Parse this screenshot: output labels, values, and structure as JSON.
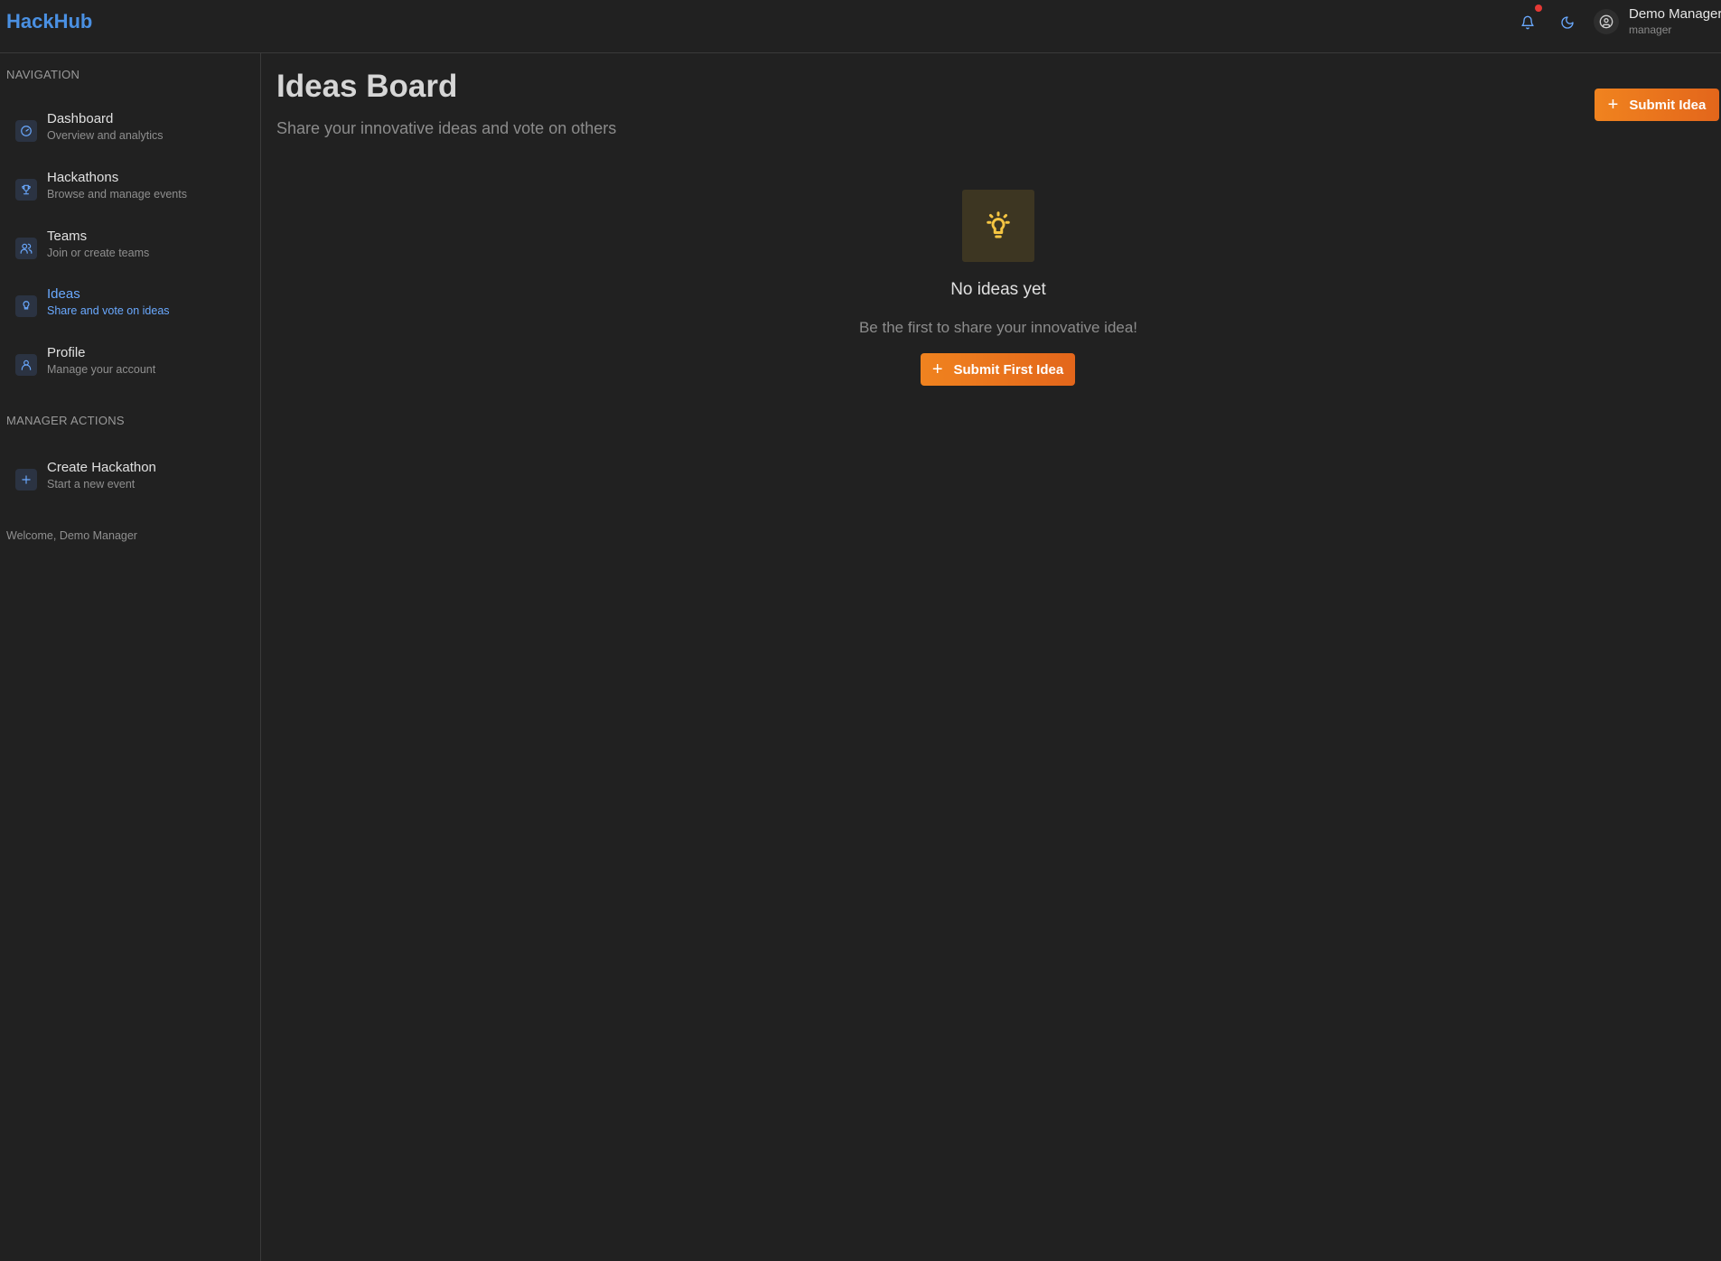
{
  "header": {
    "brand": "HackHub",
    "user_name": "Demo Manager",
    "user_role": "manager",
    "notification_icon": "bell-icon",
    "theme_icon": "moon-icon",
    "avatar_icon": "user-circle-icon"
  },
  "sidebar": {
    "nav_title": "NAVIGATION",
    "items": [
      {
        "label": "Dashboard",
        "sub": "Overview and analytics",
        "icon": "gauge-icon"
      },
      {
        "label": "Hackathons",
        "sub": "Browse and manage events",
        "icon": "trophy-icon"
      },
      {
        "label": "Teams",
        "sub": "Join or create teams",
        "icon": "users-icon"
      },
      {
        "label": "Ideas",
        "sub": "Share and vote on ideas",
        "icon": "lightbulb-icon",
        "active": true
      },
      {
        "label": "Profile",
        "sub": "Manage your account",
        "icon": "user-icon"
      }
    ],
    "manager_title": "MANAGER ACTIONS",
    "manager_items": [
      {
        "label": "Create Hackathon",
        "sub": "Start a new event",
        "icon": "plus-icon"
      }
    ],
    "welcome": "Welcome, Demo Manager"
  },
  "main": {
    "title": "Ideas Board",
    "subtitle": "Share your innovative ideas and vote on others",
    "submit_label": "Submit Idea",
    "empty": {
      "icon": "lightbulb-icon",
      "title": "No ideas yet",
      "subtitle": "Be the first to share your innovative idea!",
      "button_label": "Submit First Idea"
    }
  },
  "colors": {
    "background": "#212121",
    "accent_blue": "#4a90e2",
    "accent_orange": "#ed7a1e",
    "notification_dot": "#e53935",
    "bulb_yellow": "#f5c542"
  }
}
